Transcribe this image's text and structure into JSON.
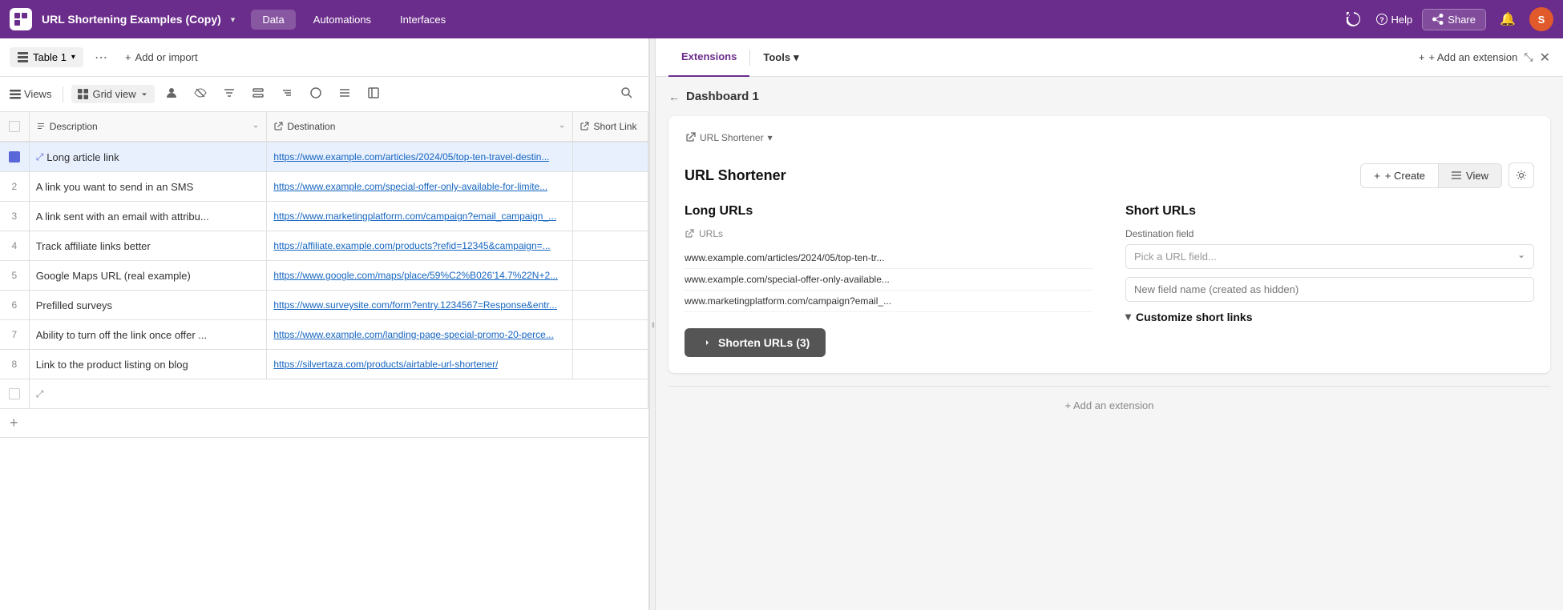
{
  "topNav": {
    "appTitle": "URL Shortening Examples (Copy)",
    "navItems": [
      "Data",
      "Automations",
      "Interfaces"
    ],
    "activeNav": "Data",
    "helpLabel": "Help",
    "shareLabel": "Share",
    "avatarInitial": "S"
  },
  "tableToolbar": {
    "tableTab": "Table 1",
    "addImportLabel": "Add or import"
  },
  "viewsToolbar": {
    "viewsLabel": "Views",
    "gridViewLabel": "Grid view"
  },
  "gridColumns": {
    "descriptionLabel": "Description",
    "destinationLabel": "Destination",
    "shortLinkLabel": "Short Link"
  },
  "gridRows": [
    {
      "rowNum": "",
      "description": "Long article link",
      "destination": "https://www.example.com/articles/2024/05/top-ten-travel-destin...",
      "shortLink": "",
      "selected": true,
      "expanded": true
    },
    {
      "rowNum": "2",
      "description": "A link you want to send in an SMS",
      "destination": "https://www.example.com/special-offer-only-available-for-limite...",
      "shortLink": "",
      "selected": false
    },
    {
      "rowNum": "3",
      "description": "A link sent with an email with attribu...",
      "destination": "https://www.marketingplatform.com/campaign?email_campaign_...",
      "shortLink": "",
      "selected": false
    },
    {
      "rowNum": "4",
      "description": "Track affiliate links better",
      "destination": "https://affiliate.example.com/products?refid=12345&campaign=...",
      "shortLink": "",
      "selected": false
    },
    {
      "rowNum": "5",
      "description": "Google Maps URL (real example)",
      "destination": "https://www.google.com/maps/place/59%C2%B026'14.7%22N+2...",
      "shortLink": "",
      "selected": false
    },
    {
      "rowNum": "6",
      "description": "Prefilled surveys",
      "destination": "https://www.surveysite.com/form?entry.1234567=Response&entr...",
      "shortLink": "",
      "selected": false
    },
    {
      "rowNum": "7",
      "description": "Ability to turn off the link once offer ...",
      "destination": "https://www.example.com/landing-page-special-promo-20-perce...",
      "shortLink": "",
      "selected": false
    },
    {
      "rowNum": "8",
      "description": "Link to the product listing on blog",
      "destination": "https://silvertaza.com/products/airtable-url-shortener/",
      "shortLink": "",
      "selected": false
    }
  ],
  "rightPanel": {
    "extensionsTab": "Extensions",
    "toolsTab": "Tools",
    "dashboardTitle": "Dashboard 1",
    "addExtensionLabel": "+ Add an extension",
    "urlShortenerLabel": "URL Shortener",
    "createLabel": "+ Create",
    "viewLabel": "View",
    "longUrlsTitle": "Long URLs",
    "shortUrlsTitle": "Short URLs",
    "urlsIconLabel": "URLs",
    "destinationFieldLabel": "Destination field",
    "pickUrlFieldPlaceholder": "Pick a URL field...",
    "newFieldNamePlaceholder": "New field name (created as hidden)",
    "customizeShortLinksLabel": "Customize short links",
    "shortenBtnLabel": "Shorten URLs (3)",
    "addExtensionFooter": "+ Add an extension",
    "urlListItems": [
      "www.example.com/articles/2024/05/top-ten-tr...",
      "www.example.com/special-offer-only-available...",
      "www.marketingplatform.com/campaign?email_..."
    ]
  }
}
